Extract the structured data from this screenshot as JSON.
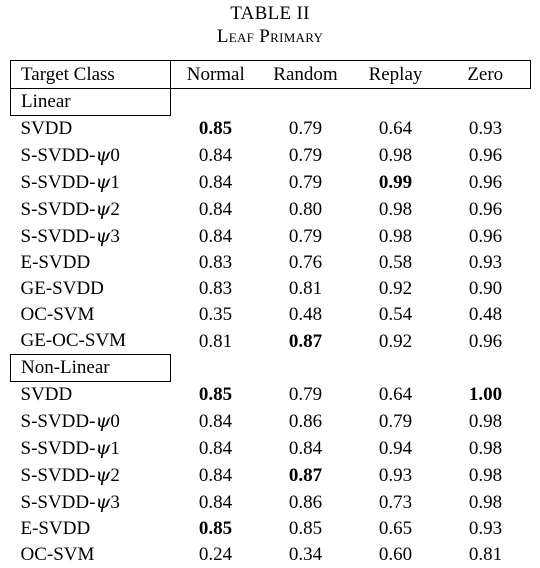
{
  "caption": {
    "title": "TABLE II",
    "subtitle": "Leaf Primary"
  },
  "table": {
    "columns": [
      "Target Class",
      "Normal",
      "Random",
      "Replay",
      "Zero"
    ],
    "sections": [
      {
        "name": "Linear",
        "rows": [
          {
            "label": "SVDD",
            "psi": null,
            "values": [
              "0.85",
              "0.79",
              "0.64",
              "0.93"
            ],
            "bold": [
              true,
              false,
              false,
              false
            ]
          },
          {
            "label": "S-SVDD-",
            "psi": "0",
            "values": [
              "0.84",
              "0.79",
              "0.98",
              "0.96"
            ],
            "bold": [
              false,
              false,
              false,
              false
            ]
          },
          {
            "label": "S-SVDD-",
            "psi": "1",
            "values": [
              "0.84",
              "0.79",
              "0.99",
              "0.96"
            ],
            "bold": [
              false,
              false,
              true,
              false
            ]
          },
          {
            "label": "S-SVDD-",
            "psi": "2",
            "values": [
              "0.84",
              "0.80",
              "0.98",
              "0.96"
            ],
            "bold": [
              false,
              false,
              false,
              false
            ]
          },
          {
            "label": "S-SVDD-",
            "psi": "3",
            "values": [
              "0.84",
              "0.79",
              "0.98",
              "0.96"
            ],
            "bold": [
              false,
              false,
              false,
              false
            ]
          },
          {
            "label": "E-SVDD",
            "psi": null,
            "values": [
              "0.83",
              "0.76",
              "0.58",
              "0.93"
            ],
            "bold": [
              false,
              false,
              false,
              false
            ]
          },
          {
            "label": "GE-SVDD",
            "psi": null,
            "values": [
              "0.83",
              "0.81",
              "0.92",
              "0.90"
            ],
            "bold": [
              false,
              false,
              false,
              false
            ]
          },
          {
            "label": "OC-SVM",
            "psi": null,
            "values": [
              "0.35",
              "0.48",
              "0.54",
              "0.48"
            ],
            "bold": [
              false,
              false,
              false,
              false
            ]
          },
          {
            "label": "GE-OC-SVM",
            "psi": null,
            "values": [
              "0.81",
              "0.87",
              "0.92",
              "0.96"
            ],
            "bold": [
              false,
              true,
              false,
              false
            ]
          }
        ]
      },
      {
        "name": "Non-Linear",
        "rows": [
          {
            "label": "SVDD",
            "psi": null,
            "values": [
              "0.85",
              "0.79",
              "0.64",
              "1.00"
            ],
            "bold": [
              true,
              false,
              false,
              true
            ]
          },
          {
            "label": "S-SVDD-",
            "psi": "0",
            "values": [
              "0.84",
              "0.86",
              "0.79",
              "0.98"
            ],
            "bold": [
              false,
              false,
              false,
              false
            ]
          },
          {
            "label": "S-SVDD-",
            "psi": "1",
            "values": [
              "0.84",
              "0.84",
              "0.94",
              "0.98"
            ],
            "bold": [
              false,
              false,
              false,
              false
            ]
          },
          {
            "label": "S-SVDD-",
            "psi": "2",
            "values": [
              "0.84",
              "0.87",
              "0.93",
              "0.98"
            ],
            "bold": [
              false,
              true,
              false,
              false
            ]
          },
          {
            "label": "S-SVDD-",
            "psi": "3",
            "values": [
              "0.84",
              "0.86",
              "0.73",
              "0.98"
            ],
            "bold": [
              false,
              false,
              false,
              false
            ]
          },
          {
            "label": "E-SVDD",
            "psi": null,
            "values": [
              "0.85",
              "0.85",
              "0.65",
              "0.93"
            ],
            "bold": [
              true,
              false,
              false,
              false
            ]
          },
          {
            "label": "OC-SVM",
            "psi": null,
            "values": [
              "0.24",
              "0.34",
              "0.60",
              "0.81"
            ],
            "bold": [
              false,
              false,
              false,
              false
            ]
          }
        ]
      }
    ]
  }
}
